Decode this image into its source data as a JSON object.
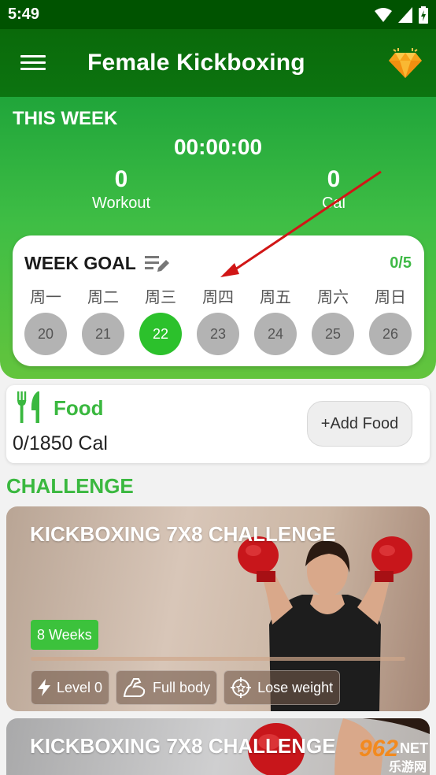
{
  "status": {
    "time": "5:49"
  },
  "app": {
    "title": "Female Kickboxing"
  },
  "week": {
    "heading": "THIS WEEK",
    "timer": "00:00:00",
    "workout": {
      "value": "0",
      "label": "Workout"
    },
    "calories": {
      "value": "0",
      "label": "Cal"
    }
  },
  "goal": {
    "title": "WEEK GOAL",
    "count": "0/5",
    "days": [
      {
        "label": "周一",
        "date": "20"
      },
      {
        "label": "周二",
        "date": "21"
      },
      {
        "label": "周三",
        "date": "22"
      },
      {
        "label": "周四",
        "date": "23"
      },
      {
        "label": "周五",
        "date": "24"
      },
      {
        "label": "周六",
        "date": "25"
      },
      {
        "label": "周日",
        "date": "26"
      }
    ],
    "active_index": 2
  },
  "food": {
    "title": "Food",
    "calories": "0/1850 Cal",
    "add_label": "+Add Food"
  },
  "challenge": {
    "heading": "CHALLENGE",
    "cards": [
      {
        "title": "KICKBOXING 7X8 CHALLENGE",
        "weeks": "8 Weeks",
        "level": "Level 0",
        "focus": "Full body",
        "goal": "Lose weight"
      },
      {
        "title": "KICKBOXING 7X8 CHALLENGE"
      }
    ]
  },
  "watermark": {
    "number": "962",
    "suffix": ".NET",
    "site": "乐游网"
  },
  "colors": {
    "primary_dark": "#005300",
    "accent_green": "#3ab83f",
    "active_day": "#2cc12c",
    "inactive_day": "#b3b3b3"
  }
}
